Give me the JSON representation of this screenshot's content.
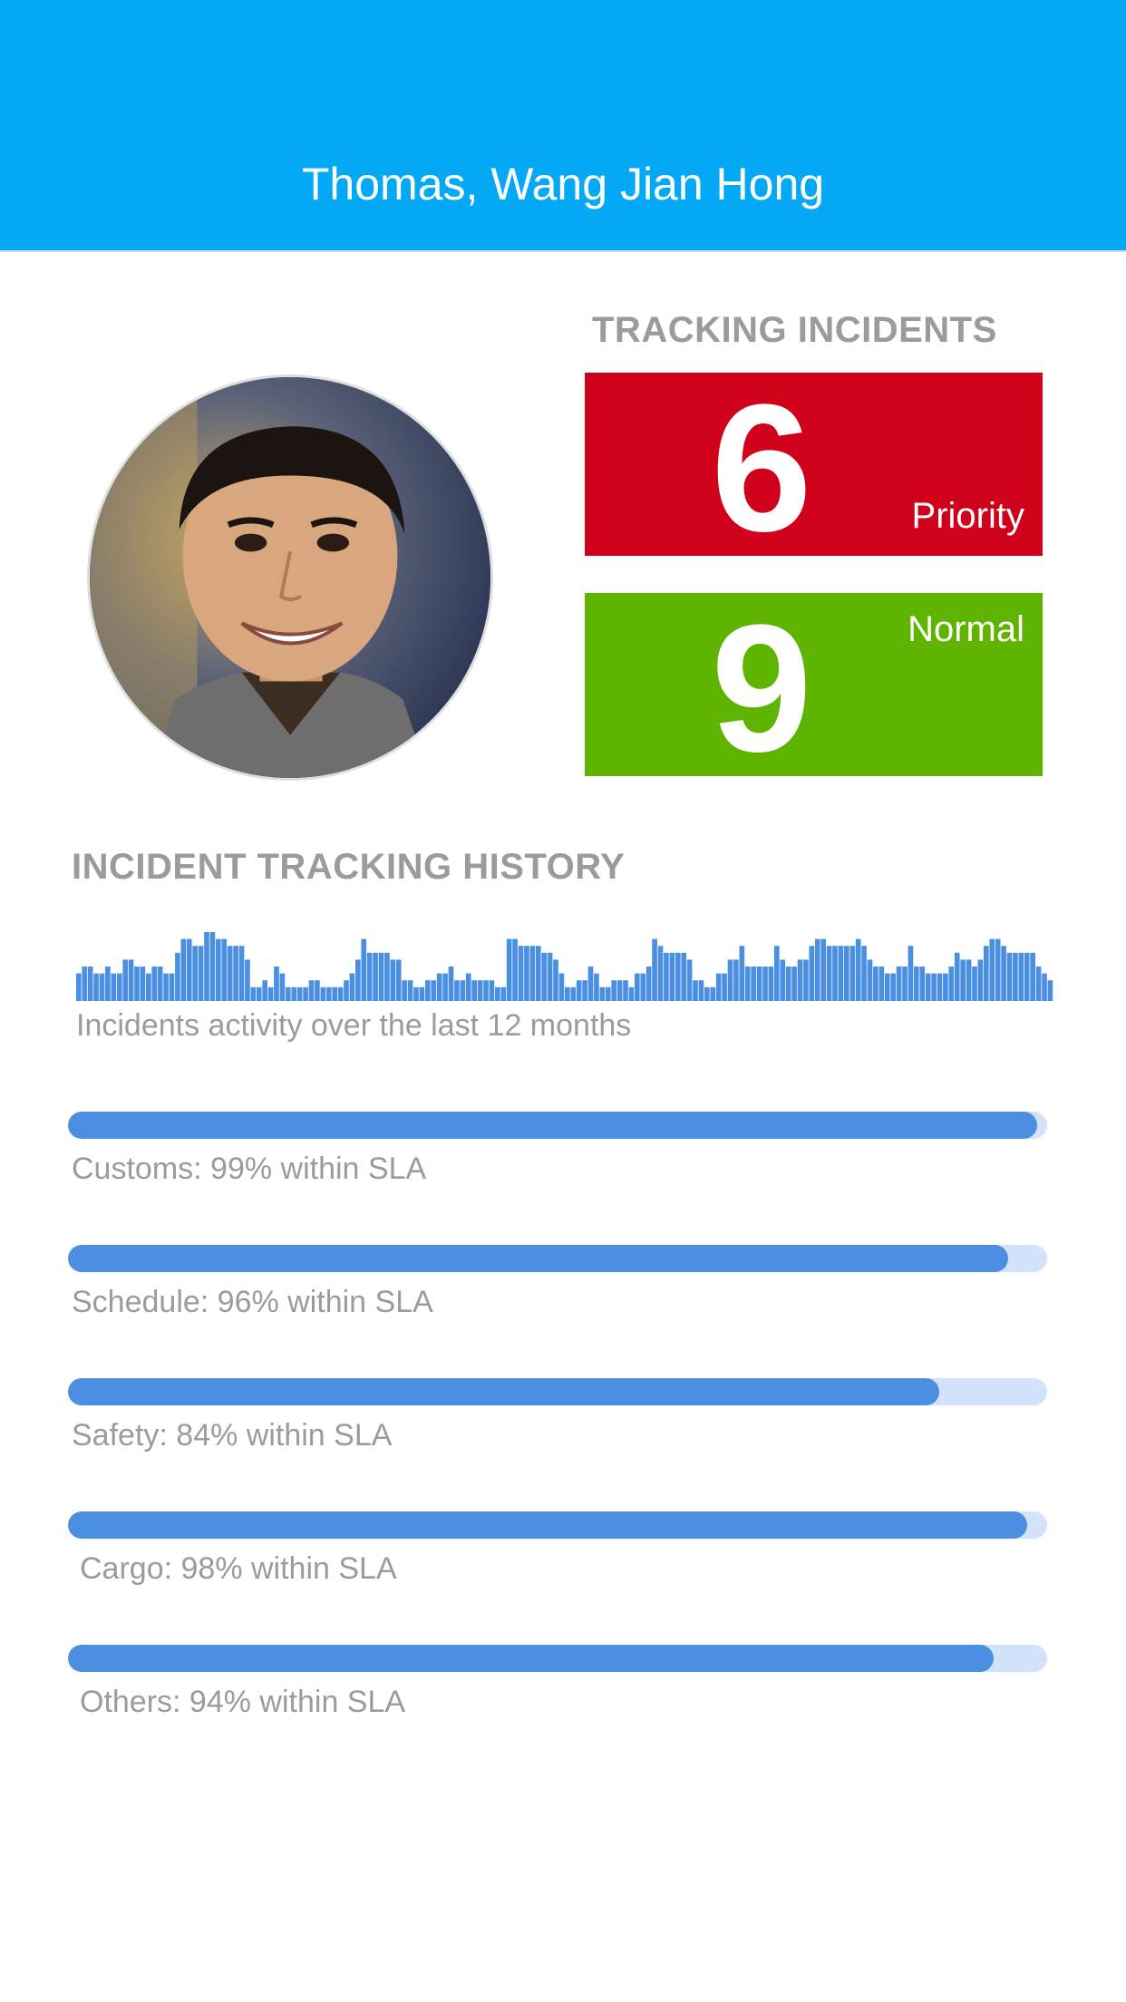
{
  "header": {
    "title": "Thomas, Wang Jian Hong"
  },
  "profile": {
    "avatar_icon": "person-photo"
  },
  "tracking": {
    "heading": "TRACKING INCIDENTS",
    "priority": {
      "count": "6",
      "label": "Priority",
      "color": "#d0021b"
    },
    "normal": {
      "count": "9",
      "label": "Normal",
      "color": "#5fb400"
    }
  },
  "history": {
    "heading": "INCIDENT TRACKING HISTORY",
    "caption": "Incidents activity over the last 12 months",
    "bar_color": "#4a8fe2",
    "activity": [
      4,
      5,
      5,
      4,
      4,
      5,
      4,
      4,
      6,
      6,
      5,
      5,
      4,
      5,
      5,
      4,
      4,
      7,
      9,
      9,
      8,
      8,
      10,
      10,
      9,
      9,
      8,
      8,
      8,
      6,
      2,
      2,
      3,
      2,
      5,
      4,
      2,
      2,
      2,
      2,
      3,
      3,
      2,
      2,
      2,
      2,
      3,
      4,
      6,
      9,
      7,
      7,
      7,
      7,
      6,
      6,
      3,
      3,
      2,
      2,
      3,
      3,
      4,
      4,
      5,
      3,
      3,
      4,
      3,
      3,
      3,
      3,
      2,
      2,
      9,
      9,
      8,
      8,
      8,
      8,
      7,
      7,
      6,
      4,
      2,
      2,
      3,
      3,
      5,
      4,
      2,
      2,
      3,
      3,
      3,
      2,
      4,
      4,
      5,
      9,
      8,
      7,
      7,
      7,
      7,
      6,
      3,
      3,
      2,
      2,
      4,
      4,
      6,
      6,
      8,
      5,
      5,
      5,
      5,
      5,
      8,
      6,
      5,
      5,
      6,
      6,
      8,
      9,
      9,
      8,
      8,
      8,
      8,
      8,
      9,
      8,
      6,
      5,
      5,
      4,
      4,
      5,
      5,
      8,
      5,
      5,
      4,
      4,
      4,
      4,
      5,
      7,
      6,
      6,
      5,
      6,
      8,
      9,
      9,
      8,
      7,
      7,
      7,
      7,
      7,
      5,
      4,
      3
    ]
  },
  "sla": {
    "track_color": "#d2e3fb",
    "fill_color": "#4a8fe2",
    "items": [
      {
        "label": "Customs: 99% within SLA",
        "value": 0.99
      },
      {
        "label": "Schedule: 96% within SLA",
        "value": 0.96
      },
      {
        "label": "Safety: 84% within SLA",
        "value": 0.89
      },
      {
        "label": "Cargo: 98% within SLA",
        "value": 0.98
      },
      {
        "label": "Others: 94% within SLA",
        "value": 0.945
      }
    ]
  }
}
